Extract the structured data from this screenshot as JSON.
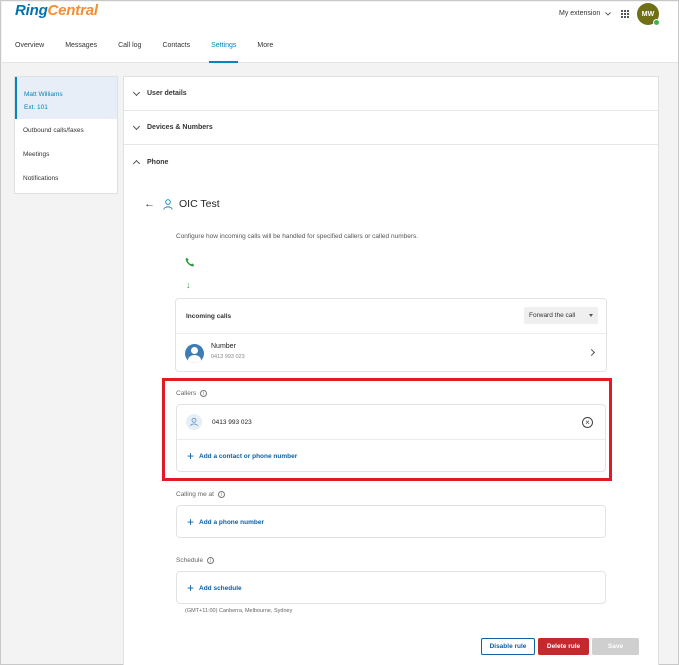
{
  "app": {
    "logo_ring": "Ring",
    "logo_central": "Central"
  },
  "header": {
    "extension_menu": "My extension",
    "avatar_initials": "MW",
    "nav": [
      "Overview",
      "Messages",
      "Call log",
      "Contacts",
      "Settings",
      "More"
    ],
    "active_nav": "Settings"
  },
  "sidebar": {
    "user_name": "Matt Williams",
    "user_ext": "Ext. 101",
    "items": [
      "Outbound calls/faxes",
      "Meetings",
      "Notifications"
    ]
  },
  "sections": {
    "user_details": "User details",
    "devices_numbers": "Devices & Numbers",
    "phone": "Phone"
  },
  "rule": {
    "title": "OIC Test",
    "description": "Configure how incoming calls will be handled for specified callers or called numbers.",
    "incoming_label": "Incoming calls",
    "action": "Forward the call",
    "number_label": "Number",
    "number_value": "0413 993 023"
  },
  "callers": {
    "label": "Callers",
    "caller_number": "0413 993 023",
    "add_label": "Add a contact or phone number"
  },
  "calling_me_at": {
    "label": "Calling me at",
    "add_label": "Add a phone number"
  },
  "schedule": {
    "label": "Schedule",
    "add_label": "Add schedule",
    "timezone": "(GMT+11:00) Canberra, Melbourne, Sydney"
  },
  "buttons": {
    "disable": "Disable rule",
    "delete": "Delete rule",
    "save": "Save"
  },
  "colors": {
    "accent": "#0684bd",
    "highlight": "#e01b24",
    "delete": "#c6292d",
    "phone_green": "#2e9b3e"
  }
}
